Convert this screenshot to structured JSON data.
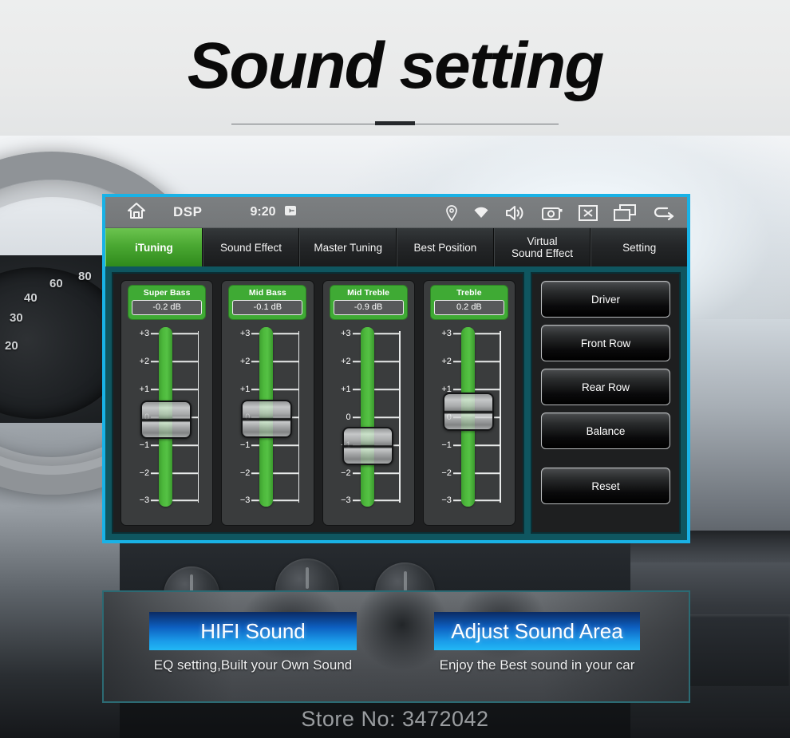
{
  "page": {
    "title": "Sound setting",
    "store_no": "Store No: 3472042"
  },
  "statusbar": {
    "home_icon": "home-icon",
    "app_label": "DSP",
    "time": "9:20",
    "badge_icon": "sd-card-icon",
    "right_icons": [
      "location-pin-icon",
      "wifi-icon",
      "volume-icon",
      "camera-icon",
      "close-box-icon",
      "recent-apps-icon",
      "back-arrow-icon"
    ]
  },
  "tabs": [
    {
      "label": "iTuning",
      "active": true
    },
    {
      "label": "Sound Effect",
      "active": false
    },
    {
      "label": "Master Tuning",
      "active": false
    },
    {
      "label": "Best Position",
      "active": false
    },
    {
      "label": "Virtual\nSound Effect",
      "line1": "Virtual",
      "line2": "Sound Effect",
      "active": false
    },
    {
      "label": "Setting",
      "active": false
    }
  ],
  "equalizer": {
    "scale_ticks": [
      "+3",
      "+2",
      "+1",
      "0",
      "−1",
      "−2",
      "−3"
    ],
    "bands": [
      {
        "name": "Super Bass",
        "value": "-0.2 dB",
        "db": -0.2
      },
      {
        "name": "Mid Bass",
        "value": "-0.1 dB",
        "db": -0.1
      },
      {
        "name": "Mid Treble",
        "value": "-0.9 dB",
        "db": -0.9
      },
      {
        "name": "Treble",
        "value": "0.2 dB",
        "db": 0.2
      }
    ]
  },
  "side_buttons": [
    {
      "label": "Driver"
    },
    {
      "label": "Front Row"
    },
    {
      "label": "Rear Row"
    },
    {
      "label": "Balance"
    },
    {
      "label": "Reset"
    }
  ],
  "banner": {
    "promo_left_title": "HIFI Sound",
    "promo_left_sub": "EQ setting,Built your Own Sound",
    "promo_right_title": "Adjust Sound Area",
    "promo_right_sub": "Enjoy the Best sound in your car"
  },
  "colors": {
    "accent_cyan": "#19b2e6",
    "teal_frame": "#0f5660",
    "green": "#3faa34",
    "promo_blue": "#1a9ae8"
  }
}
